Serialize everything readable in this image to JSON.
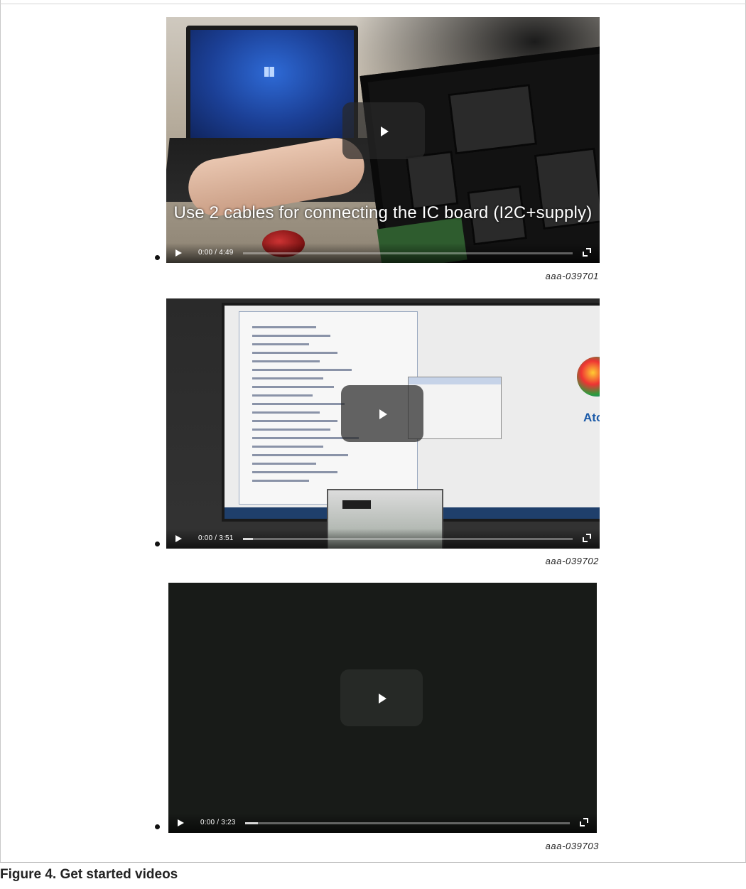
{
  "videos": [
    {
      "subtitle": "Use 2 cables for connecting the IC board (I2C+supply)",
      "time_display": "0:00 / 4:49",
      "progress": 0,
      "caption_id": "aaa-039701"
    },
    {
      "brand_text": "AtoS",
      "time_display": "0:00 / 3:51",
      "progress": 0.03,
      "caption_id": "aaa-039702"
    },
    {
      "time_display": "0:00 / 3:23",
      "progress": 0.04,
      "caption_id": "aaa-039703"
    }
  ],
  "figure": {
    "title": "Figure 4.  Get started videos"
  },
  "icons": [
    "play-icon",
    "fullscreen-icon",
    "bullet-icon"
  ]
}
